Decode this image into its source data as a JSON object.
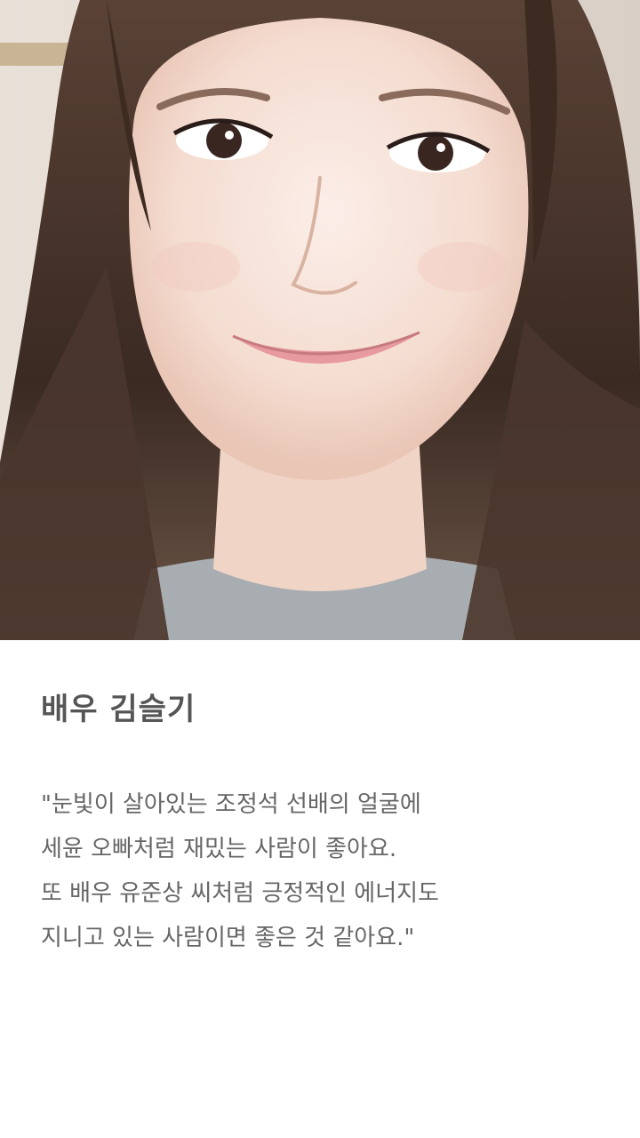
{
  "photo": {
    "alt_name": "profile-photo"
  },
  "profile": {
    "title": "배우 김슬기",
    "quote_lines": [
      "\"눈빛이 살아있는 조정석 선배의 얼굴에",
      "세윤 오빠처럼 재밌는 사람이 좋아요.",
      "또 배우 유준상 씨처럼 긍정적인 에너지도",
      "지니고 있는 사람이면 좋은 것 같아요.\""
    ]
  },
  "colors": {
    "background": "#ffffff",
    "title": "#555555",
    "body_text": "#666666",
    "hair": "#3f2d24",
    "skin": "#f6e3da"
  }
}
